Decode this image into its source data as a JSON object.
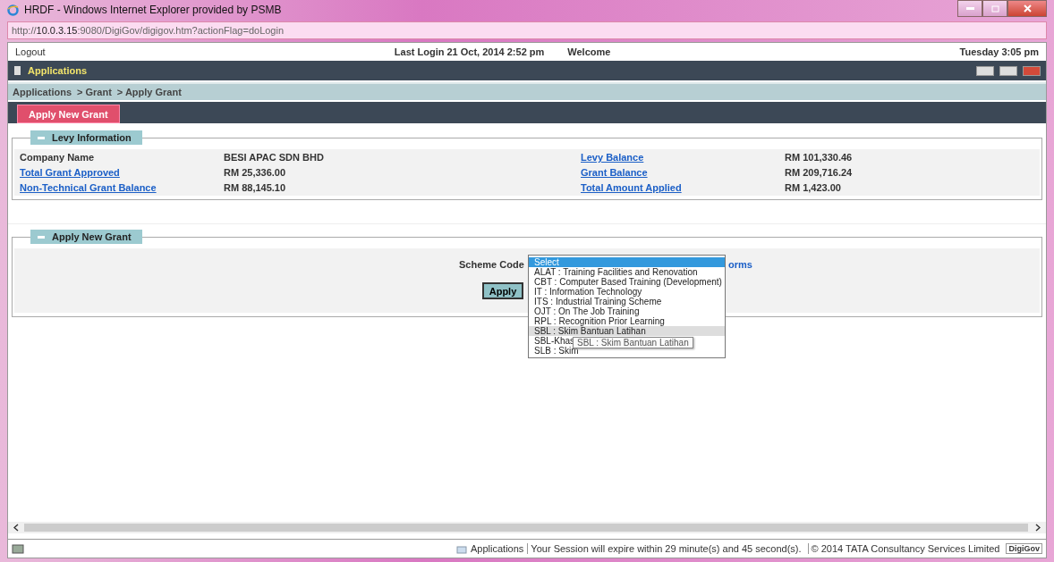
{
  "window": {
    "title": "HRDF - Windows Internet Explorer provided by PSMB",
    "address": {
      "prefix": "http://",
      "host": "10.0.3.15",
      "rest": ":9080/DigiGov/digigov.htm?actionFlag=doLogin"
    }
  },
  "topbar": {
    "logout": "Logout",
    "last_login": "Last Login 21 Oct, 2014 2:52 pm",
    "welcome": "Welcome",
    "datetime": "Tuesday 3:05 pm"
  },
  "appbar": {
    "title": "Applications"
  },
  "breadcrumb": [
    "Applications",
    "> Grant",
    "> Apply Grant"
  ],
  "tabs": [
    {
      "label": "Apply New Grant",
      "selected": true
    }
  ],
  "levy": {
    "legend": "Levy Information",
    "rows": [
      {
        "label": "Company Name",
        "link": false,
        "value": "BESI APAC SDN BHD"
      },
      {
        "label": "Levy Balance",
        "link": true,
        "value": "RM 101,330.46"
      },
      {
        "label": "Total Grant Approved",
        "link": true,
        "value": "RM 25,336.00"
      },
      {
        "label": "Grant Balance",
        "link": true,
        "value": "RM 209,716.24"
      },
      {
        "label": "Non-Technical Grant Balance",
        "link": true,
        "value": "RM 88,145.10"
      },
      {
        "label": "Total Amount Applied",
        "link": true,
        "value": "RM 1,423.00"
      }
    ]
  },
  "apply": {
    "legend": "Apply New Grant",
    "scheme_label": "Scheme Code",
    "link_fragment": "orms",
    "button": "Apply",
    "options": [
      {
        "label": "Select",
        "selected": true,
        "hovered": false
      },
      {
        "label": "ALAT : Training Facilities and Renovation",
        "selected": false,
        "hovered": false
      },
      {
        "label": "CBT : Computer Based Training (Development)",
        "selected": false,
        "hovered": false
      },
      {
        "label": "IT : Information Technology",
        "selected": false,
        "hovered": false
      },
      {
        "label": "ITS : Industrial Training Scheme",
        "selected": false,
        "hovered": false
      },
      {
        "label": "OJT : On The Job Training",
        "selected": false,
        "hovered": false
      },
      {
        "label": "RPL : Recognition Prior Learning",
        "selected": false,
        "hovered": false
      },
      {
        "label": "SBL : Skim Bantuan Latihan",
        "selected": false,
        "hovered": true
      },
      {
        "label": "SBL-Khas",
        "selected": false,
        "hovered": false
      },
      {
        "label": "SLB : Skim",
        "selected": false,
        "hovered": false
      }
    ],
    "tooltip": "SBL : Skim Bantuan Latihan"
  },
  "status_bar": {
    "app": "Applications",
    "session": "Your Session will expire within 29 minute(s) and 45 second(s).",
    "copyright": "© 2014 TATA Consultancy Services Limited",
    "badge": "DigiGov"
  }
}
